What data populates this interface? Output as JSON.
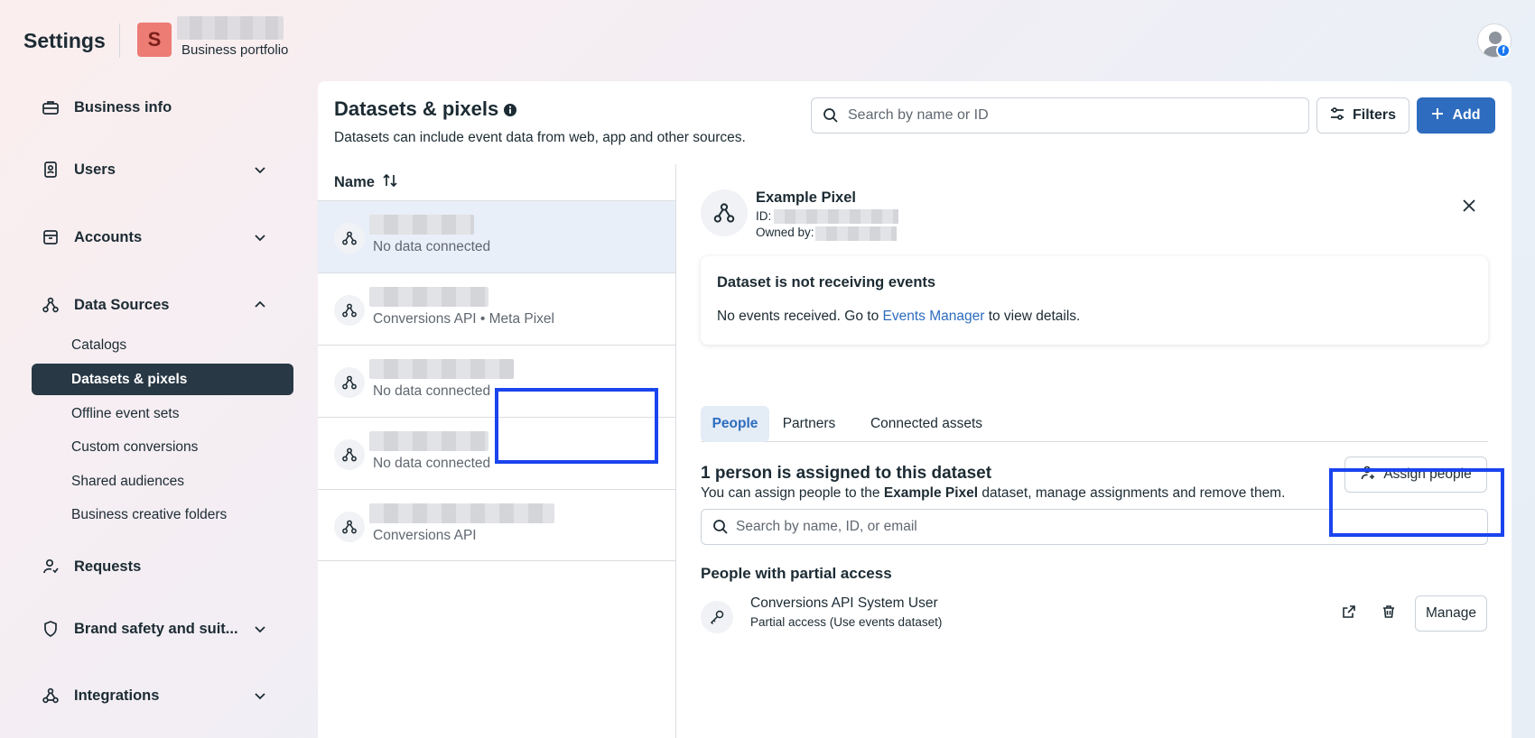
{
  "header": {
    "app_title": "Settings",
    "portfolio_initial": "S",
    "portfolio_label": "Business portfolio"
  },
  "sidebar": {
    "items": [
      {
        "label": "Business info",
        "icon": "briefcase-icon"
      },
      {
        "label": "Users",
        "icon": "id-badge-icon",
        "expanded": false
      },
      {
        "label": "Accounts",
        "icon": "archive-icon",
        "expanded": false
      },
      {
        "label": "Data Sources",
        "icon": "data-sources-icon",
        "expanded": true
      },
      {
        "label": "Requests",
        "icon": "person-request-icon"
      },
      {
        "label": "Brand safety and suit...",
        "icon": "shield-icon",
        "expanded": false
      },
      {
        "label": "Integrations",
        "icon": "integrations-icon",
        "expanded": false
      }
    ],
    "sub_items": [
      {
        "label": "Catalogs",
        "active": false
      },
      {
        "label": "Datasets & pixels",
        "active": true
      },
      {
        "label": "Offline event sets",
        "active": false
      },
      {
        "label": "Custom conversions",
        "active": false
      },
      {
        "label": "Shared audiences",
        "active": false
      },
      {
        "label": "Business creative folders",
        "active": false
      }
    ]
  },
  "main": {
    "title": "Datasets & pixels",
    "subtitle": "Datasets can include event data from web, app and other sources.",
    "search_placeholder": "Search by name or ID",
    "filters_label": "Filters",
    "add_label": "Add"
  },
  "list": {
    "header": "Name",
    "rows": [
      {
        "subtitle": "No data connected",
        "selected": true
      },
      {
        "subtitle": "Conversions API • Meta Pixel",
        "selected": false
      },
      {
        "subtitle": "No data connected",
        "selected": false
      },
      {
        "subtitle": "No data connected",
        "selected": false
      },
      {
        "subtitle": "Conversions API",
        "selected": false
      }
    ]
  },
  "detail": {
    "name": "Example Pixel",
    "id_label": "ID:",
    "owned_by_label": "Owned by:",
    "alert_title": "Dataset is not receiving events",
    "alert_text_before": "No events received. Go to ",
    "alert_link": "Events Manager",
    "alert_text_after": " to view details.",
    "tabs": [
      {
        "label": "People",
        "active": true
      },
      {
        "label": "Partners",
        "active": false
      },
      {
        "label": "Connected assets",
        "active": false
      }
    ],
    "assigned_title": "1 person is assigned to this dataset",
    "assigned_desc_before": "You can assign people to the ",
    "assigned_desc_bold": "Example Pixel",
    "assigned_desc_after": " dataset, manage assignments and remove them.",
    "assign_button": "Assign people",
    "people_search_placeholder": "Search by name, ID, or email",
    "partial_title": "People with partial access",
    "person": {
      "name": "Conversions API System User",
      "access": "Partial access (Use events dataset)"
    },
    "manage_button": "Manage"
  },
  "colors": {
    "accent": "#2d6cbe",
    "active_nav": "#283845",
    "highlight": "#1a44ee"
  }
}
